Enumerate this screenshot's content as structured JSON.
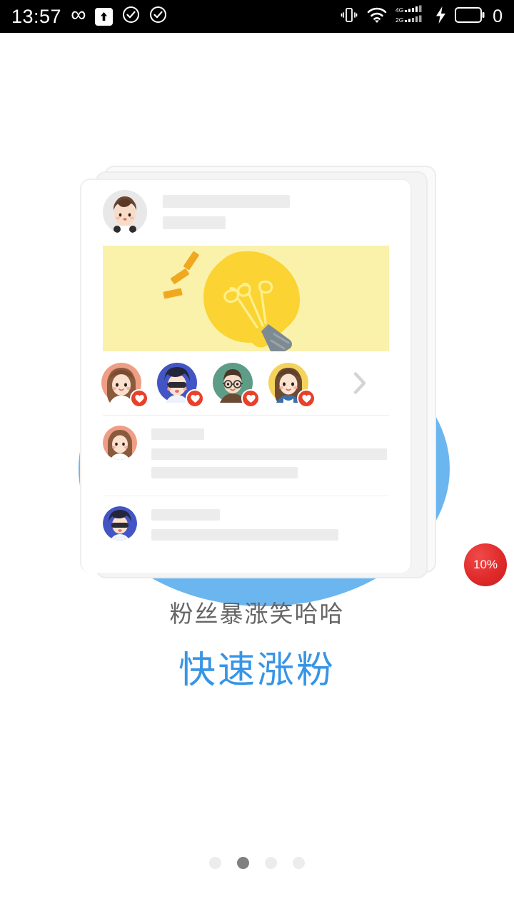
{
  "status_bar": {
    "time": "13:57",
    "infinity_glyph": "∞",
    "battery_text": "0",
    "left_icons": [
      "infinity-icon",
      "upload-arrow-icon",
      "check-circle-icon",
      "check-circle-icon"
    ],
    "right_icons": [
      "vibrate-icon",
      "wifi-icon",
      "signal-4g-icon",
      "signal-2g-icon",
      "charging-bolt-icon",
      "battery-icon"
    ],
    "signal_labels": {
      "sim1": "4G",
      "sim2": "2G"
    },
    "background": "#000000",
    "foreground": "#ffffff"
  },
  "illustration": {
    "name": "social-feed-card-illustration",
    "blue_circle_color": "#6cb6f0",
    "hero_background": "#faf1ab",
    "bulb_color": "#fbd332",
    "bulb_base_color": "#7d8a92",
    "ray_color": "#f0a91f",
    "card_background": "#ffffff",
    "placeholder_color": "#ececec",
    "header_avatar": {
      "name": "post-author-avatar",
      "bg": "#e8e8e8",
      "hair": "#6d4630",
      "skin": "#f8dcc8"
    },
    "like_avatars": [
      {
        "name": "liker-avatar-1",
        "bg": "#ef9e86",
        "hair": "#8a5a3d",
        "skin": "#fbe0cf"
      },
      {
        "name": "liker-avatar-2",
        "bg": "#4355c4",
        "hair": "#23263b",
        "skin": "#fbe0cf"
      },
      {
        "name": "liker-avatar-3",
        "bg": "#5d9c86",
        "hair": "#4a3526",
        "skin": "#f6ddc8"
      },
      {
        "name": "liker-avatar-4",
        "bg": "#f5d35a",
        "hair": "#6d4a32",
        "skin": "#fbe3d2"
      }
    ],
    "heart_badge_color": "#e8402a",
    "chevron": "chevron-right-icon",
    "comments": [
      {
        "name": "comment-row-1",
        "avatar_bg": "#ef9e86",
        "hair": "#8a5a3d",
        "name_bar_width": 74,
        "text_bars": [
          330,
          205
        ]
      },
      {
        "name": "comment-row-2",
        "avatar_bg": "#4355c4",
        "hair": "#23263b",
        "name_bar_width": 96,
        "text_bars": [
          262
        ]
      }
    ],
    "progress_badge": {
      "label": "10%",
      "color": "#e02a2a"
    }
  },
  "captions": {
    "subtitle": "粉丝暴涨笑哈哈",
    "title": "快速涨粉",
    "subtitle_color": "#666666",
    "title_color": "#3795e5"
  },
  "pager": {
    "total": 4,
    "active_index": 1,
    "active_color": "#808080",
    "inactive_color": "#ececec"
  }
}
